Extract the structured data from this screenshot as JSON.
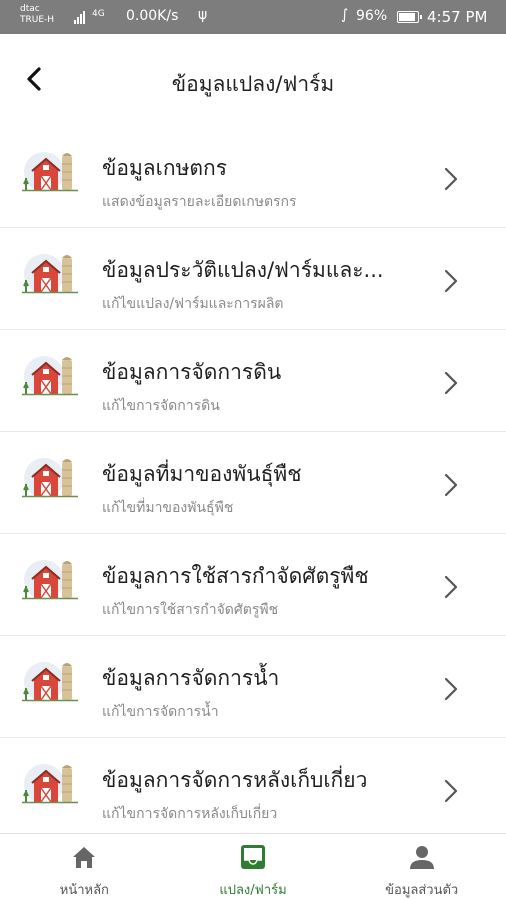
{
  "status_bar": {
    "carrier_line1": "dtac",
    "carrier_line2": "TRUE-H",
    "net_type": "4G",
    "speed": "0.00K/s",
    "battery": "96%",
    "time": "4:57 PM"
  },
  "header": {
    "title": "ข้อมูลแปลง/ฟาร์ม"
  },
  "items": [
    {
      "title": "ข้อมูลเกษตกร",
      "subtitle": "แสดงข้อมูลรายละเอียดเกษตรกร"
    },
    {
      "title": "ข้อมูลประวัติแปลง/ฟาร์มและ...",
      "subtitle": "แก้ไขแปลง/ฟาร์มและการผลิต"
    },
    {
      "title": "ข้อมูลการจัดการดิน",
      "subtitle": "แก้ไขการจัดการดิน"
    },
    {
      "title": "ข้อมูลที่มาของพันธุ์พืช",
      "subtitle": "แก้ไขที่มาของพันธุ์พืช"
    },
    {
      "title": "ข้อมูลการใช้สารกำจัดศัตรูพืช",
      "subtitle": "แก้ไขการใช้สารกำจัดศัตรูพืช"
    },
    {
      "title": "ข้อมูลการจัดการน้ำ",
      "subtitle": "แก้ไขการจัดการน้ำ"
    },
    {
      "title": "ข้อมูลการจัดการหลังเก็บเกี่ยว",
      "subtitle": "แก้ไขการจัดการหลังเก็บเกี่ยว"
    }
  ],
  "bottom_nav": {
    "home_label": "หน้าหลัก",
    "farm_label": "แปลง/ฟาร์ม",
    "profile_label": "ข้อมูลส่วนตัว",
    "active": "farm"
  },
  "colors": {
    "status_bar_bg": "#7d7d7d",
    "active_nav": "#2e7d32",
    "inactive_nav": "#555555",
    "barn_red": "#d9473b"
  },
  "icons": {
    "back": "chevron-left-icon",
    "row": "barn-icon",
    "row_action": "chevron-right-icon",
    "home": "home-icon",
    "farm": "inbox-icon",
    "profile": "person-icon"
  }
}
